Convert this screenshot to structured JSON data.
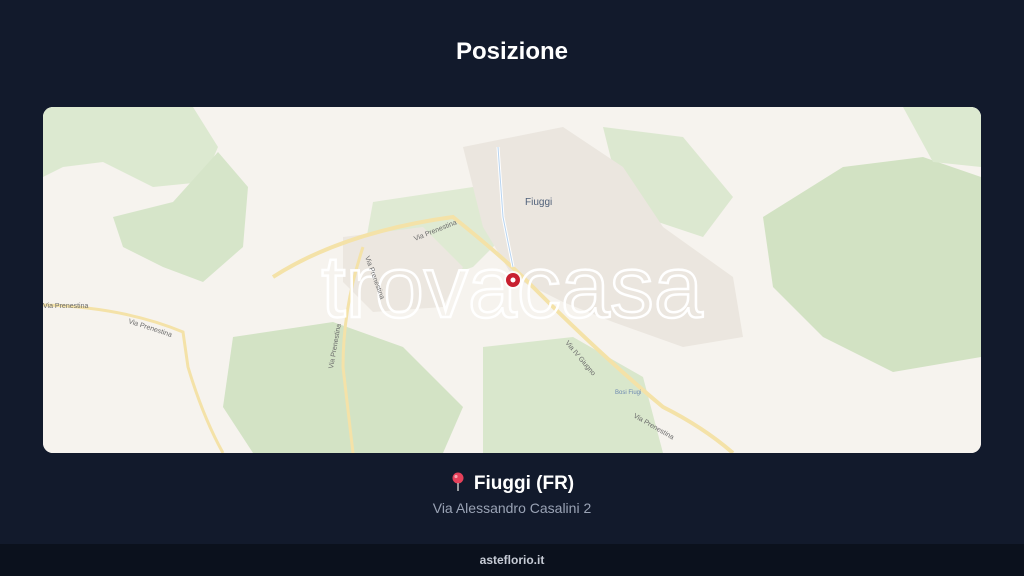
{
  "header": {
    "title": "Posizione"
  },
  "map": {
    "watermark": "trovacasa",
    "labels": {
      "town": "Fiuggi",
      "road1": "Via Prenestina",
      "road2": "Via Prenestina",
      "road3": "Via Prenestina",
      "road4": "Via Prenestina",
      "road5": "Via Prenestina",
      "road6": "Via Prenestina",
      "road7": "Via IV Giugno",
      "poi": "Bosi Fiugi"
    },
    "marker_icon": "map-marker-icon",
    "colors": {
      "land": "#f6f3ee",
      "green": "#dce9d0",
      "urban": "#ebe6df",
      "road": "#f4e2a8",
      "marker": "#c8202f"
    }
  },
  "location": {
    "pin_icon": "pin-icon",
    "name": "Fiuggi (FR)",
    "address": "Via Alessandro Casalini 2"
  },
  "footer": {
    "site": "asteflorio.it"
  }
}
